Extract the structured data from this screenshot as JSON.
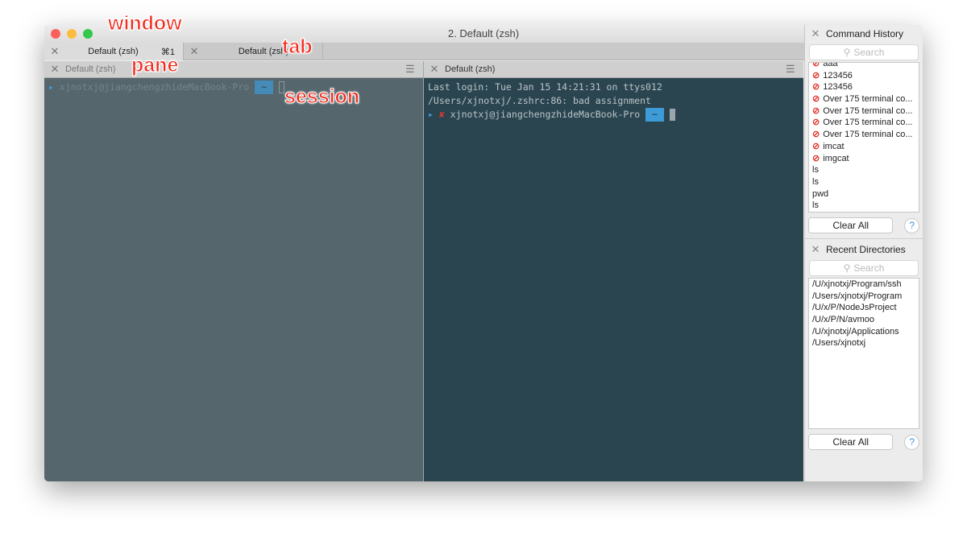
{
  "window": {
    "title": "2. Default (zsh)",
    "traffic_colors": [
      "#fc605c",
      "#fdbc40",
      "#34c84a"
    ]
  },
  "tabs": [
    {
      "label": "Default (zsh)",
      "shortcut": "⌘1",
      "active": true
    },
    {
      "label": "Default (zsh)",
      "active": false
    }
  ],
  "panes": [
    {
      "title": "Default (zsh)",
      "lines": [],
      "prompt": "xjnotxj@jiangchengzhideMacBook-Pro",
      "dir": "~",
      "bg": "#56666d"
    },
    {
      "title": "Default (zsh)",
      "lines": [
        "Last login: Tue Jan 15 14:21:31 on ttys012",
        "/Users/xjnotxj/.zshrc:86: bad assignment"
      ],
      "status": "✘",
      "prompt": "xjnotxj@jiangchengzhideMacBook-Pro",
      "dir": "~",
      "bg": "#2b4550"
    }
  ],
  "command_history": {
    "title": "Command History",
    "search_placeholder": "Search",
    "items": [
      {
        "text": "aaa",
        "failed": true
      },
      {
        "text": "123456",
        "failed": true
      },
      {
        "text": "123456",
        "failed": true
      },
      {
        "text": "Over 175 terminal co...",
        "failed": true
      },
      {
        "text": "Over 175 terminal co...",
        "failed": true
      },
      {
        "text": "Over 175 terminal co...",
        "failed": true
      },
      {
        "text": "Over 175 terminal co...",
        "failed": true
      },
      {
        "text": "imcat",
        "failed": true
      },
      {
        "text": "imgcat",
        "failed": true
      },
      {
        "text": "ls",
        "failed": false
      },
      {
        "text": "ls",
        "failed": false
      },
      {
        "text": "pwd",
        "failed": false
      },
      {
        "text": "ls",
        "failed": false
      }
    ],
    "clear_label": "Clear All",
    "help": "?"
  },
  "recent_directories": {
    "title": "Recent Directories",
    "search_placeholder": "Search",
    "items": [
      "/U/xjnotxj/Program/ssh",
      "/Users/xjnotxj/Program",
      "/U/x/P/NodeJsProject",
      "/U/x/P/N/avmoo",
      "/U/xjnotxj/Applications",
      "/Users/xjnotxj"
    ],
    "clear_label": "Clear All",
    "help": "?"
  },
  "annotations": {
    "window": "window",
    "tab": "tab",
    "pane": "pane",
    "session": "session"
  }
}
